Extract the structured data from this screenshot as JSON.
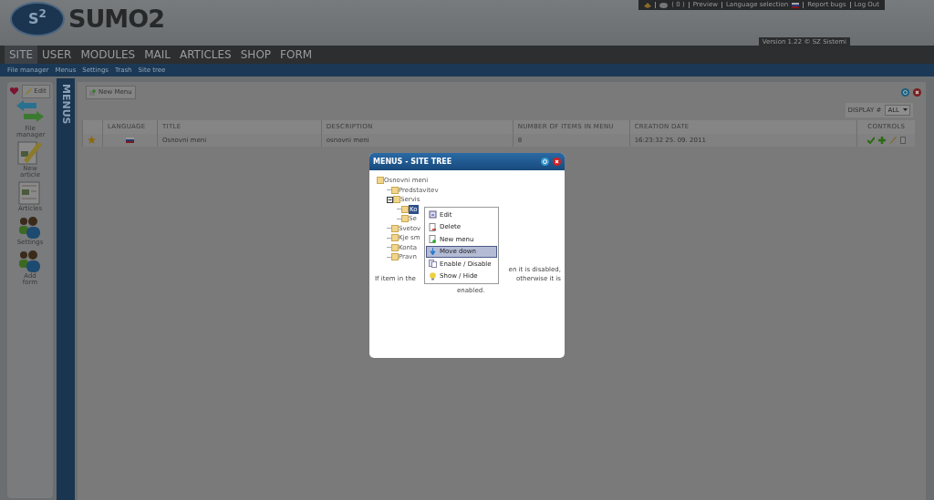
{
  "logo": {
    "badge": "S$^{2}$",
    "name": "SUMO2"
  },
  "top_bar": {
    "count": "( 0 )",
    "links": [
      {
        "label": "Preview",
        "kind": "link"
      },
      {
        "label": "Language selection",
        "kind": "flag"
      },
      {
        "label": "Report bugs",
        "kind": "link"
      },
      {
        "label": "Log Out",
        "kind": "link"
      }
    ]
  },
  "version": {
    "text": "Version 1.22 ©",
    "link": "SZ Sistemi"
  },
  "nav": [
    {
      "label": "SITE",
      "selected": true
    },
    {
      "label": "USER",
      "selected": false
    },
    {
      "label": "MODULES",
      "selected": false
    },
    {
      "label": "MAIL",
      "selected": false
    },
    {
      "label": "ARTICLES",
      "selected": false
    },
    {
      "label": "SHOP",
      "selected": false
    },
    {
      "label": "FORM",
      "selected": false
    }
  ],
  "subnav": [
    "File manager",
    "Menus",
    "Settings",
    "Trash",
    "Site tree"
  ],
  "sidebar": {
    "edit": "Edit",
    "items": [
      {
        "label": "File manager",
        "kind": "arrows"
      },
      {
        "label": "New article",
        "kind": "new"
      },
      {
        "label": "Articles",
        "kind": "doc"
      },
      {
        "label": "Settings",
        "kind": "people"
      },
      {
        "label": "Add form",
        "kind": "people"
      }
    ]
  },
  "section_title": "MENUS",
  "toolbar": {
    "new_button": "New Menu",
    "display_label": "DISPLAY #",
    "display_value": "ALL"
  },
  "table": {
    "columns": [
      "",
      "LANGUAGE",
      "TITLE",
      "DESCRIPTION",
      "NUMBER OF ITEMS IN MENU",
      "CREATION DATE",
      "CONTROLS"
    ],
    "rows": [
      {
        "title": "Osnovni meni",
        "description": "osnovni meni",
        "items": "8",
        "date": "16:23:32 25. 09. 2011"
      }
    ]
  },
  "modal": {
    "title": "MENUS - SITE TREE",
    "tree": {
      "label": "Osnovni meni",
      "children": [
        {
          "label": "Predstavitev",
          "selected": false
        },
        {
          "label": "Servis",
          "selected": false,
          "expanded": true,
          "children": [
            {
              "label": "Ko",
              "selected": true
            },
            {
              "label": "Se",
              "selected": false
            }
          ]
        },
        {
          "label": "Svetov",
          "selected": false
        },
        {
          "label": "Kje sm",
          "selected": false
        },
        {
          "label": "Konta",
          "selected": false
        },
        {
          "label": "Pravn",
          "selected": false
        }
      ]
    },
    "note": [
      "If item in the",
      "en it is disabled, otherwise it is",
      "enabled."
    ],
    "context_menu": [
      {
        "label": "Edit",
        "kind": "edit",
        "selected": false
      },
      {
        "label": "Delete",
        "kind": "delete",
        "selected": false
      },
      {
        "label": "New menu",
        "kind": "new",
        "selected": false
      },
      {
        "label": "Move down",
        "kind": "down",
        "selected": true
      },
      {
        "label": "Enable / Disable",
        "kind": "toggle",
        "selected": false
      },
      {
        "label": "Show / Hide",
        "kind": "bulb",
        "selected": false
      }
    ]
  }
}
